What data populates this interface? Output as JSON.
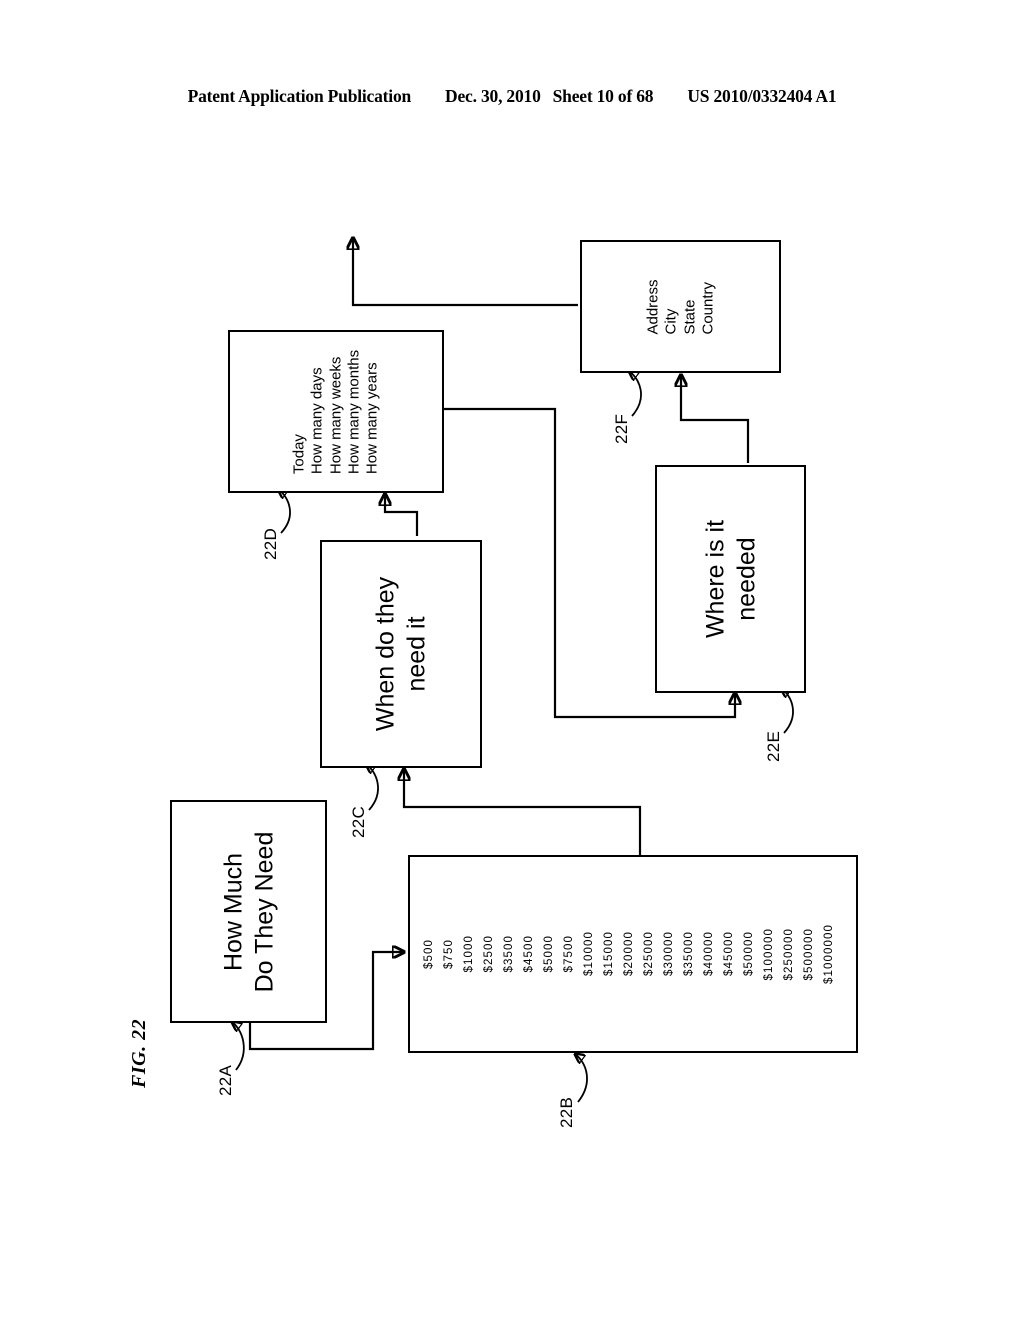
{
  "header": {
    "publication": "Patent Application Publication",
    "date": "Dec. 30, 2010",
    "sheet": "Sheet 10 of 68",
    "number": "US 2010/0332404 A1"
  },
  "figure": {
    "label": "FIG. 22"
  },
  "nodes": {
    "how_much": {
      "ref": "22A",
      "line1": "How Much",
      "line2": "Do They Need"
    },
    "amounts": {
      "ref": "22B",
      "values": [
        "$500",
        "$750",
        "$1000",
        "$2500",
        "$3500",
        "$4500",
        "$5000",
        "$7500",
        "$10000",
        "$15000",
        "$20000",
        "$25000",
        "$30000",
        "$35000",
        "$40000",
        "$45000",
        "$50000",
        "$100000",
        "$250000",
        "$500000",
        "$1000000"
      ]
    },
    "when_needed": {
      "ref": "22C",
      "line1": "When do they",
      "line2": "need it"
    },
    "timeframes": {
      "ref": "22D",
      "items": [
        "Today",
        "How many days",
        "How many weeks",
        "How many months",
        "How many years"
      ]
    },
    "where_needed": {
      "ref": "22E",
      "line1": "Where is it",
      "line2": "needed"
    },
    "location_fields": {
      "ref": "22F",
      "items": [
        "Address",
        "City",
        "State",
        "Country"
      ]
    }
  }
}
